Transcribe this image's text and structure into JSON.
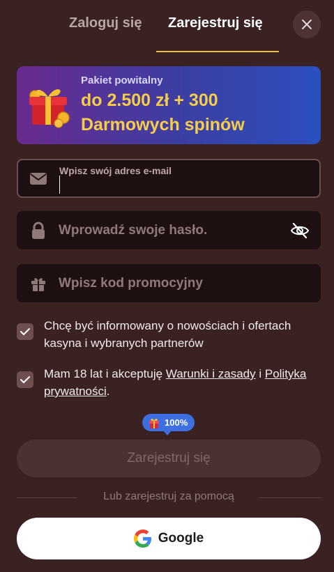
{
  "tabs": {
    "login": "Zaloguj się",
    "register": "Zarejestruj się",
    "active": "register"
  },
  "banner": {
    "label": "Pakiet powitalny",
    "line1": "do 2.500 zł + 300",
    "line2": "Darmowych spinów"
  },
  "email": {
    "label": "Wpisz swój adres e-mail",
    "value": ""
  },
  "password": {
    "placeholder": "Wprowadź swoje hasło."
  },
  "promo": {
    "placeholder": "Wpisz kod promocyjny"
  },
  "consents": {
    "marketing": {
      "text": "Chcę być informowany o nowościach i ofertach kasyna i wybranych partnerów",
      "checked": true
    },
    "terms": {
      "prefix": "Mam 18 lat i akceptuję ",
      "terms_link": "Warunki i zasady",
      "middle": " i ",
      "privacy_link": "Polityka prywatności",
      "suffix": ".",
      "checked": true
    }
  },
  "badge": {
    "text": "100%"
  },
  "submit": {
    "label": "Zarejestruj się"
  },
  "divider": {
    "text": "Lub zarejestruj za pomocą"
  },
  "google": {
    "label": "Google"
  },
  "colors": {
    "background": "#3a2222",
    "accent": "#f0c23c",
    "badge": "#3d6fe0",
    "banner_text": "#f6cd4a"
  }
}
